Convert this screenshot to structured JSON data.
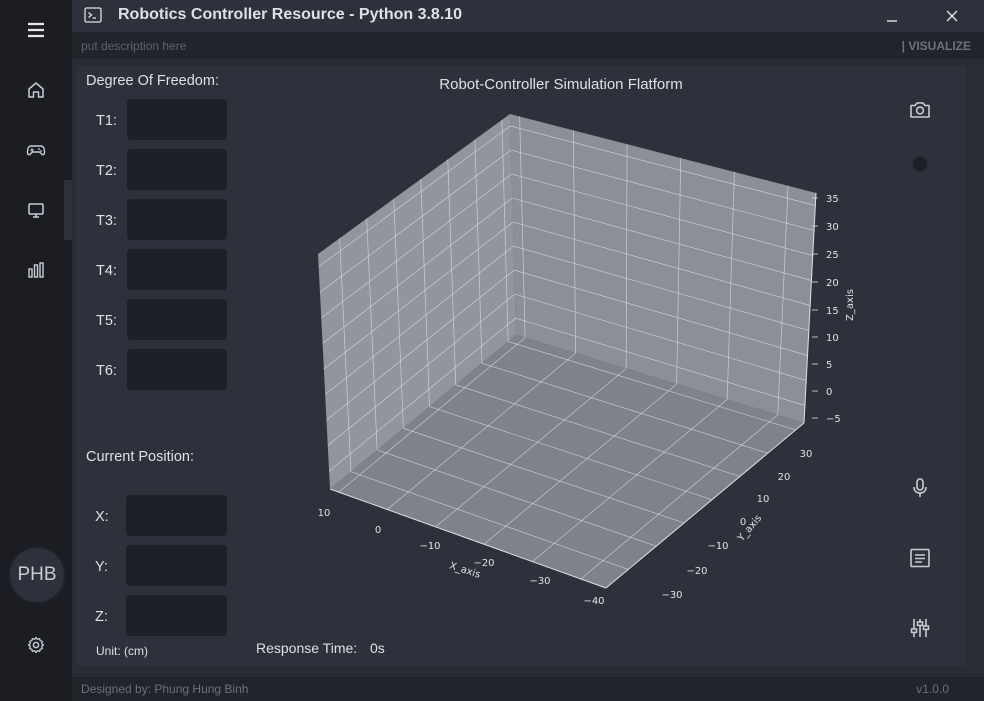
{
  "app": {
    "title": "Robotics Controller Resource - Python 3.8.10",
    "description_placeholder": "put description here",
    "page_label": "| VISUALIZE"
  },
  "nav": {
    "items": [
      {
        "name": "menu",
        "icon": "menu-icon"
      },
      {
        "name": "home",
        "icon": "home-icon"
      },
      {
        "name": "controller",
        "icon": "gamepad-icon"
      },
      {
        "name": "visualize",
        "icon": "monitor-icon",
        "active": true
      },
      {
        "name": "statistics",
        "icon": "bar-chart-icon"
      }
    ],
    "avatar_text": "PHB",
    "settings_icon": "gear-icon"
  },
  "dof": {
    "title": "Degree Of Freedom:",
    "joints": [
      {
        "label": "T1:",
        "value": ""
      },
      {
        "label": "T2:",
        "value": ""
      },
      {
        "label": "T3:",
        "value": ""
      },
      {
        "label": "T4:",
        "value": ""
      },
      {
        "label": "T5:",
        "value": ""
      },
      {
        "label": "T6:",
        "value": ""
      }
    ]
  },
  "position": {
    "title": "Current Position:",
    "coords": [
      {
        "label": "X:",
        "value": ""
      },
      {
        "label": "Y:",
        "value": ""
      },
      {
        "label": "Z:",
        "value": ""
      }
    ],
    "unit": "Unit: (cm)"
  },
  "plot": {
    "title": "Robot-Controller Simulation Flatform",
    "response_label": "Response Time:",
    "response_value": "0s"
  },
  "chart_data": {
    "type": "scatter",
    "title": "Robot-Controller Simulation Flatform",
    "xlabel": "X_axis",
    "ylabel": "Y_axis",
    "zlabel": "Z_axis",
    "x_ticks": [
      "10",
      "0",
      "−10",
      "−20",
      "−30",
      "−40"
    ],
    "y_ticks": [
      "30",
      "20",
      "10",
      "0",
      "−10",
      "−20",
      "−30"
    ],
    "z_ticks": [
      "35",
      "30",
      "25",
      "20",
      "15",
      "10",
      "5",
      "0",
      "−5"
    ],
    "xlim": [
      10,
      -40
    ],
    "ylim": [
      -30,
      30
    ],
    "zlim": [
      -5,
      35
    ],
    "grid": true,
    "series": []
  },
  "right_tools": [
    {
      "name": "camera",
      "icon": "camera-icon"
    },
    {
      "name": "record",
      "icon": "record-dot-icon"
    },
    {
      "name": "microphone",
      "icon": "microphone-icon"
    },
    {
      "name": "notes",
      "icon": "notes-icon"
    },
    {
      "name": "adjust",
      "icon": "sliders-icon"
    }
  ],
  "footer": {
    "credit": "Designed by: Phung Hung Binh",
    "version": "v1.0.0"
  }
}
